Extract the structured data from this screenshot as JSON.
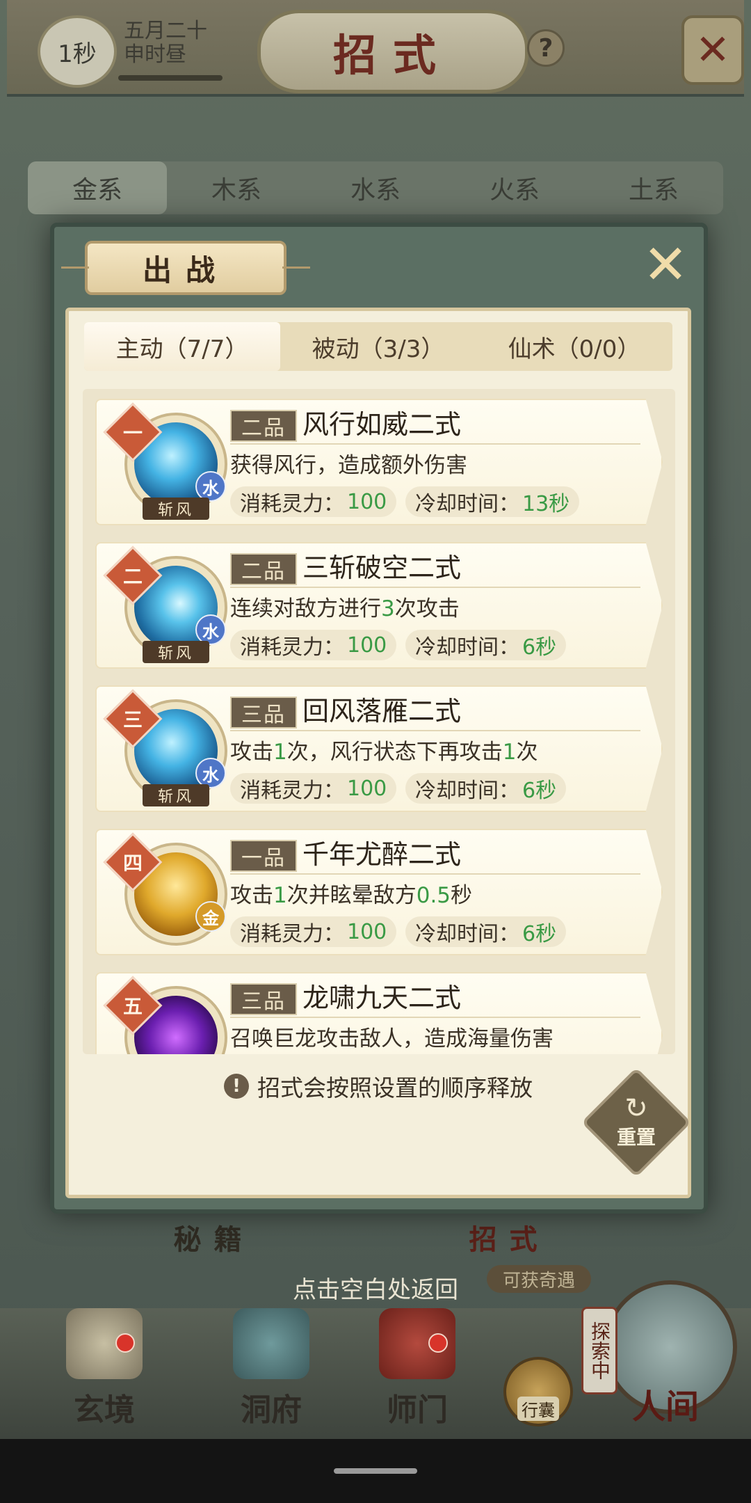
{
  "header": {
    "time_badge": "1秒",
    "date_line1": "五月二十",
    "date_line2": "申时昼",
    "title": "招式",
    "help_icon": "?"
  },
  "element_tabs": [
    "金系",
    "木系",
    "水系",
    "火系",
    "土系"
  ],
  "modal": {
    "title": "出战",
    "close_icon": "close-icon",
    "tabs": [
      {
        "label": "主动（7/7）",
        "active": true
      },
      {
        "label": "被动（3/3）",
        "active": false
      },
      {
        "label": "仙术（0/0）",
        "active": false
      }
    ],
    "stat_labels": {
      "cost": "消耗灵力：",
      "cooldown": "冷却时间："
    },
    "skills": [
      {
        "order": "一",
        "grade": "二品",
        "name": "风行如威二式",
        "desc_parts": [
          "获得风行，造成额外伤害"
        ],
        "cost": "100",
        "cooldown": "13秒",
        "element": "水",
        "type": "斩风",
        "icon": "water-sword-icon"
      },
      {
        "order": "二",
        "grade": "二品",
        "name": "三斩破空二式",
        "desc_parts": [
          "连续对敌方进行",
          "3",
          "次攻击"
        ],
        "cost": "100",
        "cooldown": "6秒",
        "element": "水",
        "type": "斩风",
        "icon": "triple-sword-icon"
      },
      {
        "order": "三",
        "grade": "三品",
        "name": "回风落雁二式",
        "desc_parts": [
          "攻击",
          "1",
          "次，风行状态下再攻击",
          "1",
          "次"
        ],
        "cost": "100",
        "cooldown": "6秒",
        "element": "水",
        "type": "斩风",
        "icon": "sword-fan-icon"
      },
      {
        "order": "四",
        "grade": "一品",
        "name": "千年尤醉二式",
        "desc_parts": [
          "攻击",
          "1",
          "次并眩晕敌方",
          "0.5",
          "秒"
        ],
        "cost": "100",
        "cooldown": "6秒",
        "element": "金",
        "type": "",
        "icon": "golden-buddha-icon"
      },
      {
        "order": "五",
        "grade": "三品",
        "name": "龙啸九天二式",
        "desc_parts": [
          "召唤巨龙攻击敌人，造成海量伤害"
        ],
        "cost": "",
        "cooldown": "",
        "element": "",
        "type": "",
        "icon": "purple-dragon-icon"
      }
    ],
    "hint": "招式会按照设置的顺序释放",
    "reset_label": "重置"
  },
  "bottom_tabs": [
    {
      "label": "秘籍",
      "active": false
    },
    {
      "label": "招式",
      "active": true
    }
  ],
  "return_hint": "点击空白处返回",
  "adventure_tag": "可获奇遇",
  "nav": {
    "items": [
      {
        "label": "玄境",
        "red_dot": true
      },
      {
        "label": "洞府",
        "red_dot": false
      },
      {
        "label": "师门",
        "red_dot": true
      }
    ],
    "bag_label": "行囊",
    "explore_badge": "探索中",
    "world_label": "人间"
  },
  "colors": {
    "highlight_green": "#3a9a45",
    "order_badge": "#c95a38",
    "modal_green": "#5b6f63"
  }
}
